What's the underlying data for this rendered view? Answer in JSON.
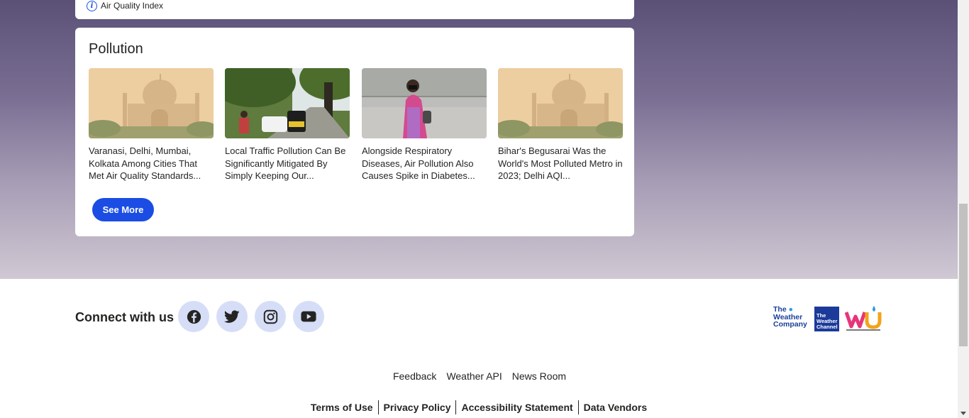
{
  "previous_card": {
    "aqi_label": "Air Quality Index"
  },
  "pollution_card": {
    "title": "Pollution",
    "articles": [
      {
        "title": "Varanasi, Delhi, Mumbai, Kolkata Among Cities That Met Air Quality Standards..."
      },
      {
        "title": "Local Traffic Pollution Can Be Significantly Mitigated By Simply Keeping Our..."
      },
      {
        "title": "Alongside Respiratory Diseases, Air Pollution Also Causes Spike in Diabetes..."
      },
      {
        "title": "Bihar's Begusarai Was the World's Most Polluted Metro in 2023; Delhi AQI..."
      }
    ],
    "see_more_label": "See More"
  },
  "footer": {
    "connect_label": "Connect with us",
    "social": [
      "facebook-icon",
      "twitter-icon",
      "instagram-icon",
      "youtube-icon"
    ],
    "logos": {
      "twc_line1": "The",
      "twc_line2": "Weather",
      "twc_line3": "Company",
      "channel_line1": "The",
      "channel_line2": "Weather",
      "channel_line3": "Channel"
    },
    "links_primary": [
      "Feedback",
      "Weather API",
      "News Room"
    ],
    "links_secondary": [
      "Terms of Use",
      "Privacy Policy",
      "Accessibility Statement",
      "Data Vendors"
    ]
  },
  "colors": {
    "accent": "#1b4de4",
    "social_bg": "#d6def7",
    "gradient_top": "#5b5076",
    "gradient_bottom": "#d0c8d3"
  }
}
